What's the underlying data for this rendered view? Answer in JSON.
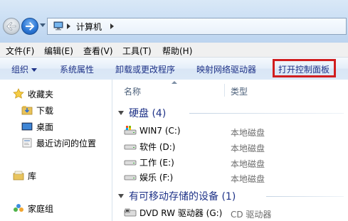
{
  "address_bar": {
    "path_label": "计算机"
  },
  "menu": {
    "items": [
      "文件(F)",
      "编辑(E)",
      "查看(V)",
      "工具(T)",
      "帮助(H)"
    ]
  },
  "commands": {
    "organize": "组织",
    "system_properties": "系统属性",
    "uninstall": "卸载或更改程序",
    "map_drive": "映射网络驱动器",
    "control_panel": "打开控制面板"
  },
  "navigation": {
    "favorites": "收藏夹",
    "downloads": "下载",
    "desktop": "桌面",
    "recent": "最近访问的位置",
    "libraries": "库",
    "homegroup": "家庭组"
  },
  "columns": {
    "name": "名称",
    "type": "类型"
  },
  "groups": {
    "hard_disks": "硬盘 (4)",
    "removable": "有可移动存储的设备 (1)"
  },
  "drives": [
    {
      "name": "WIN7 (C:)",
      "type": "本地磁盘",
      "icon": "system-drive-icon"
    },
    {
      "name": "软件 (D:)",
      "type": "本地磁盘",
      "icon": "hard-drive-icon"
    },
    {
      "name": "工作 (E:)",
      "type": "本地磁盘",
      "icon": "hard-drive-icon"
    },
    {
      "name": "娱乐 (F:)",
      "type": "本地磁盘",
      "icon": "hard-drive-icon"
    }
  ],
  "removable_devices": [
    {
      "name": "DVD RW 驱动器 (G:)",
      "type": "CD 驱动器",
      "icon": "dvd-drive-icon"
    }
  ],
  "colors": {
    "highlight_border": "#d11e1e",
    "command_text": "#1e3287",
    "group_text": "#1e3287"
  }
}
